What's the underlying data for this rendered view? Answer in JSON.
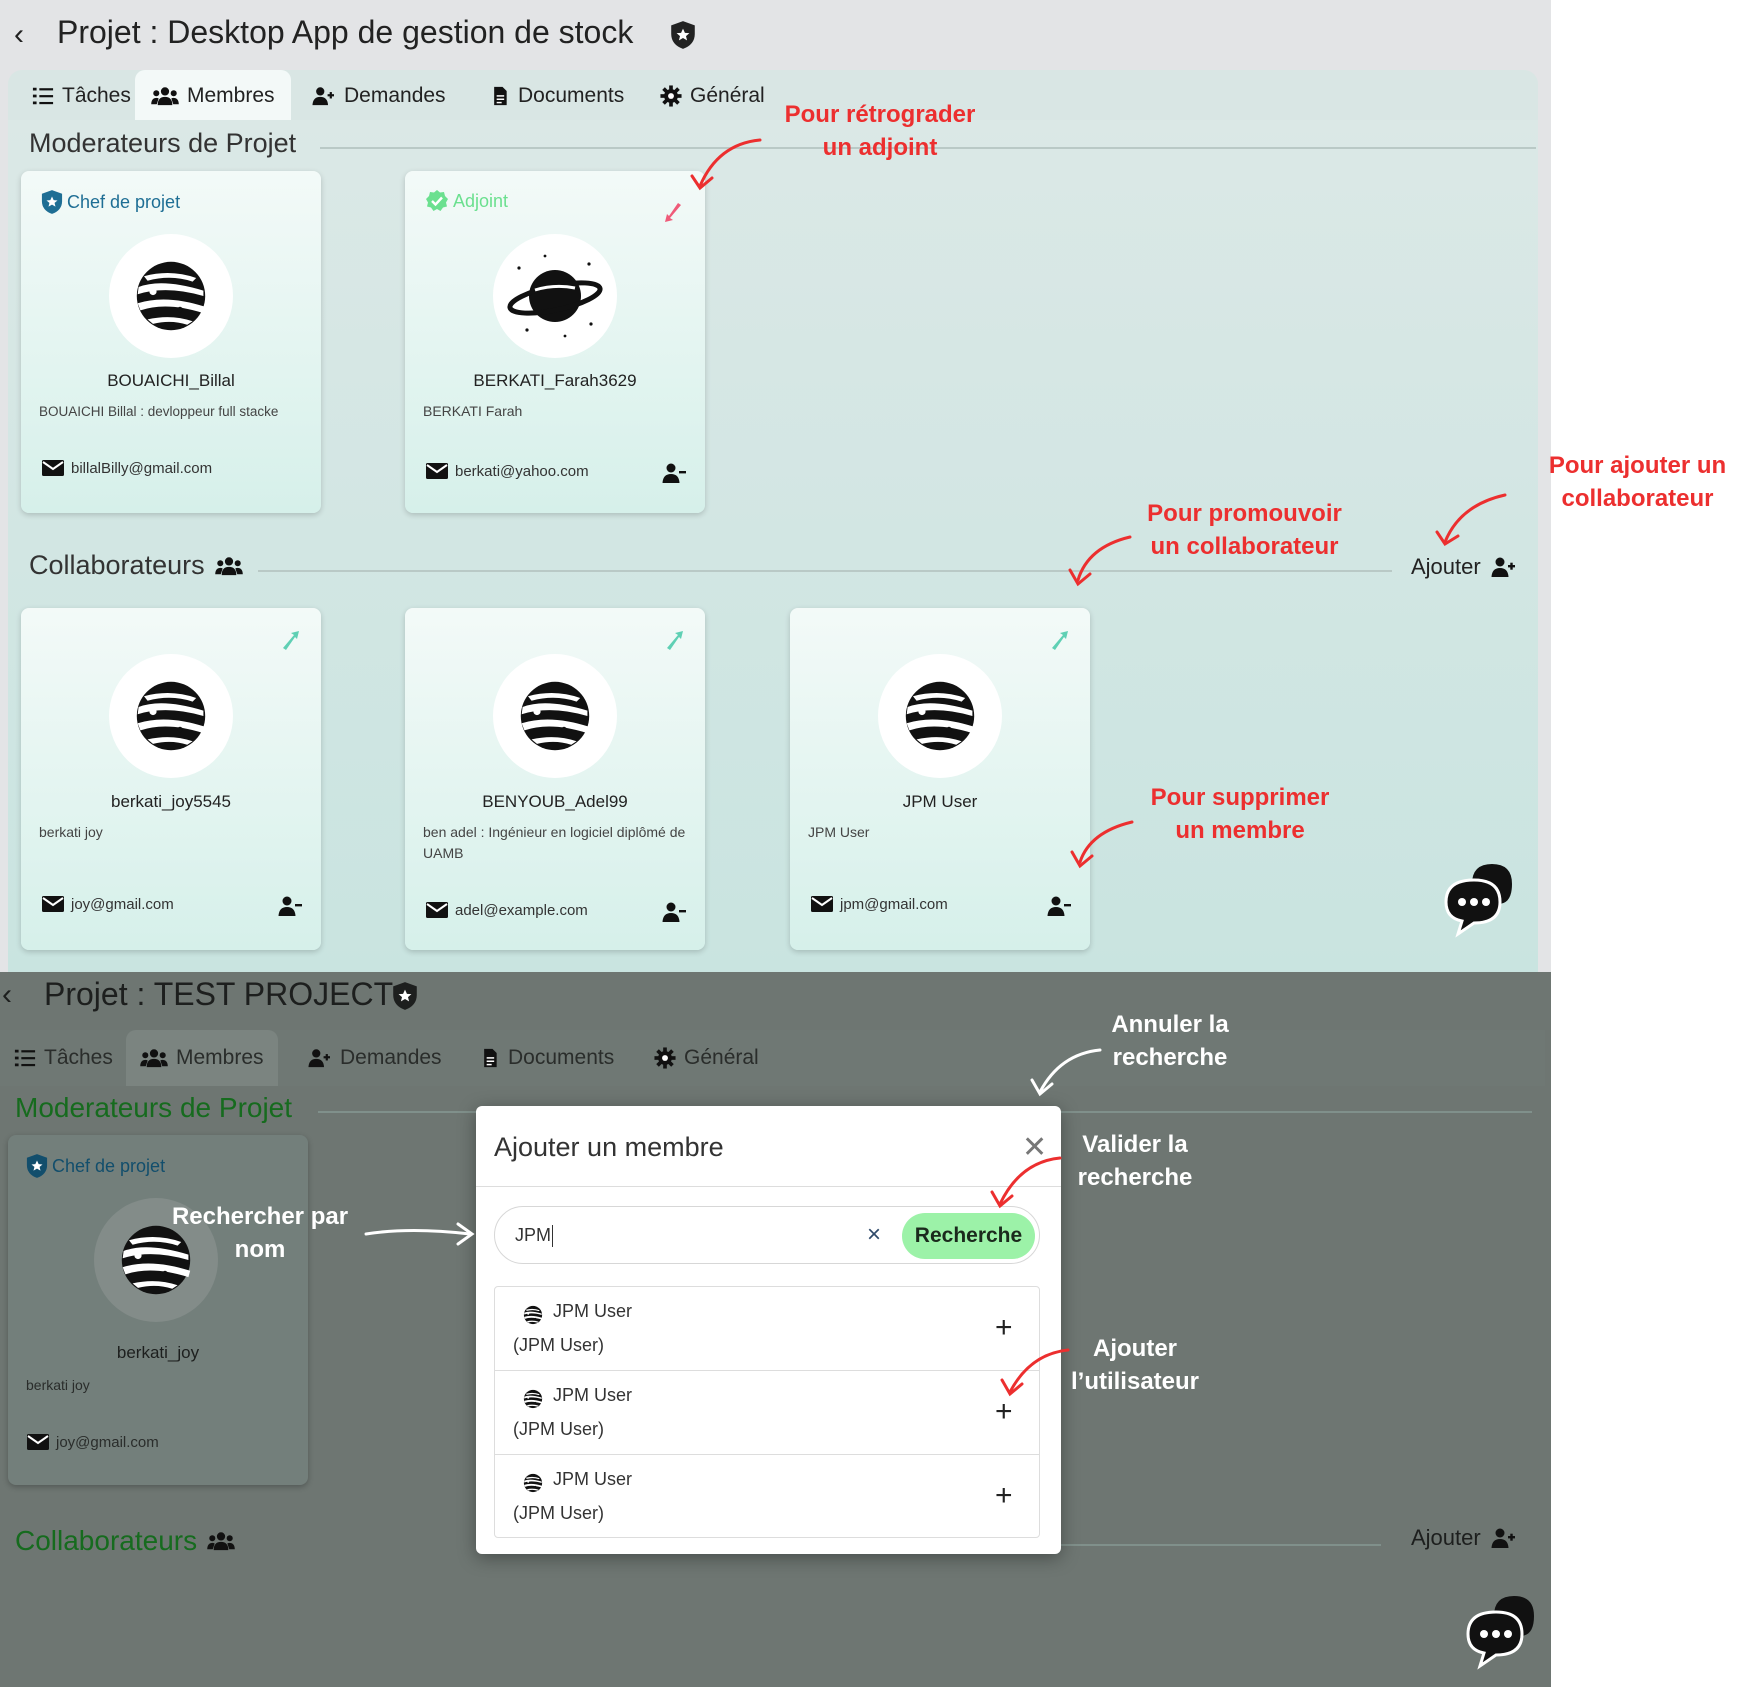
{
  "top": {
    "title": "Projet : Desktop App de gestion de stock",
    "tabs": [
      {
        "label": "Tâches",
        "icon": "list-icon"
      },
      {
        "label": "Membres",
        "icon": "users-icon"
      },
      {
        "label": "Demandes",
        "icon": "user-plus-icon"
      },
      {
        "label": "Documents",
        "icon": "document-icon"
      },
      {
        "label": "Général",
        "icon": "gear-icon"
      }
    ],
    "active_tab": "Membres",
    "moderators_title": "Moderateurs de Projet",
    "moderators": [
      {
        "role": "Chef de projet",
        "username": "BOUAICHI_Billal",
        "desc": "BOUAICHI Billal : devloppeur full stacke",
        "email": "billalBilly@gmail.com"
      },
      {
        "role": "Adjoint",
        "username": "BERKATI_Farah3629",
        "desc": "BERKATI Farah",
        "email": "berkati@yahoo.com"
      }
    ],
    "collaborators_title": "Collaborateurs",
    "add_label": "Ajouter",
    "collaborators": [
      {
        "username": "berkati_joy5545",
        "desc": "berkati joy",
        "email": "joy@gmail.com"
      },
      {
        "username": "BENYOUB_Adel99",
        "desc": "ben adel : Ingénieur en logiciel diplômé de UAMB",
        "email": "adel@example.com"
      },
      {
        "username": "JPM User",
        "desc": "JPM User",
        "email": "jpm@gmail.com"
      }
    ],
    "notes": {
      "demote": "Pour rétrograder\nun adjoint",
      "add_collab": "Pour ajouter un\ncollaborateur",
      "promote": "Pour promouvoir\nun collaborateur",
      "delete": "Pour supprimer\nun membre"
    }
  },
  "bottom": {
    "title": "Projet : TEST PROJECT",
    "tabs": [
      {
        "label": "Tâches"
      },
      {
        "label": "Membres"
      },
      {
        "label": "Demandes"
      },
      {
        "label": "Documents"
      },
      {
        "label": "Général"
      }
    ],
    "moderators_title": "Moderateurs de Projet",
    "card": {
      "role": "Chef de projet",
      "username": "berkati_joy",
      "desc": "berkati joy",
      "email": "joy@gmail.com"
    },
    "collaborators_title": "Collaborateurs",
    "add_label": "Ajouter",
    "modal": {
      "title": "Ajouter un membre",
      "search_value": "JPM",
      "search_button": "Recherche",
      "results": [
        {
          "name": "JPM User",
          "sub": "(JPM User)"
        },
        {
          "name": "JPM User",
          "sub": "(JPM User)"
        },
        {
          "name": "JPM User",
          "sub": "(JPM User)"
        }
      ]
    },
    "notes": {
      "cancel": "Annuler la\nrecherche",
      "validate": "Valider la\nrecherche",
      "search_by_name": "Rechercher par\nnom",
      "add_user": "Ajouter\nl’utilisateur"
    }
  },
  "colors": {
    "annotation_red": "#ec2f2f",
    "accent_green": "#9cf2a8",
    "card_bg": "#e6f6f2",
    "chef_blue": "#1e6e94",
    "adjoint_green": "#5ee08a"
  }
}
